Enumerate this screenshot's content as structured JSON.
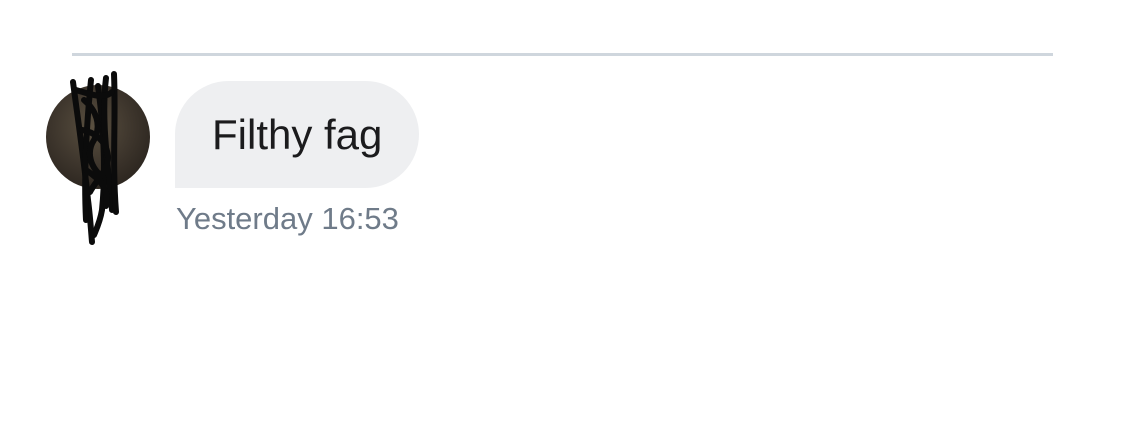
{
  "conversation": {
    "messages": [
      {
        "sender": "other",
        "text": "Filthy fag",
        "timestamp": "Yesterday 16:53"
      }
    ]
  },
  "avatar": {
    "icon": "user-avatar-photo-scribbled-out",
    "photo_color": "#3d352c",
    "scribble_color": "#0b0b0b"
  },
  "colors": {
    "divider": "#cfd6dd",
    "bubble_background": "#eeeff1",
    "message_text": "#1b1b1d",
    "timestamp_text": "#6f7b89"
  }
}
